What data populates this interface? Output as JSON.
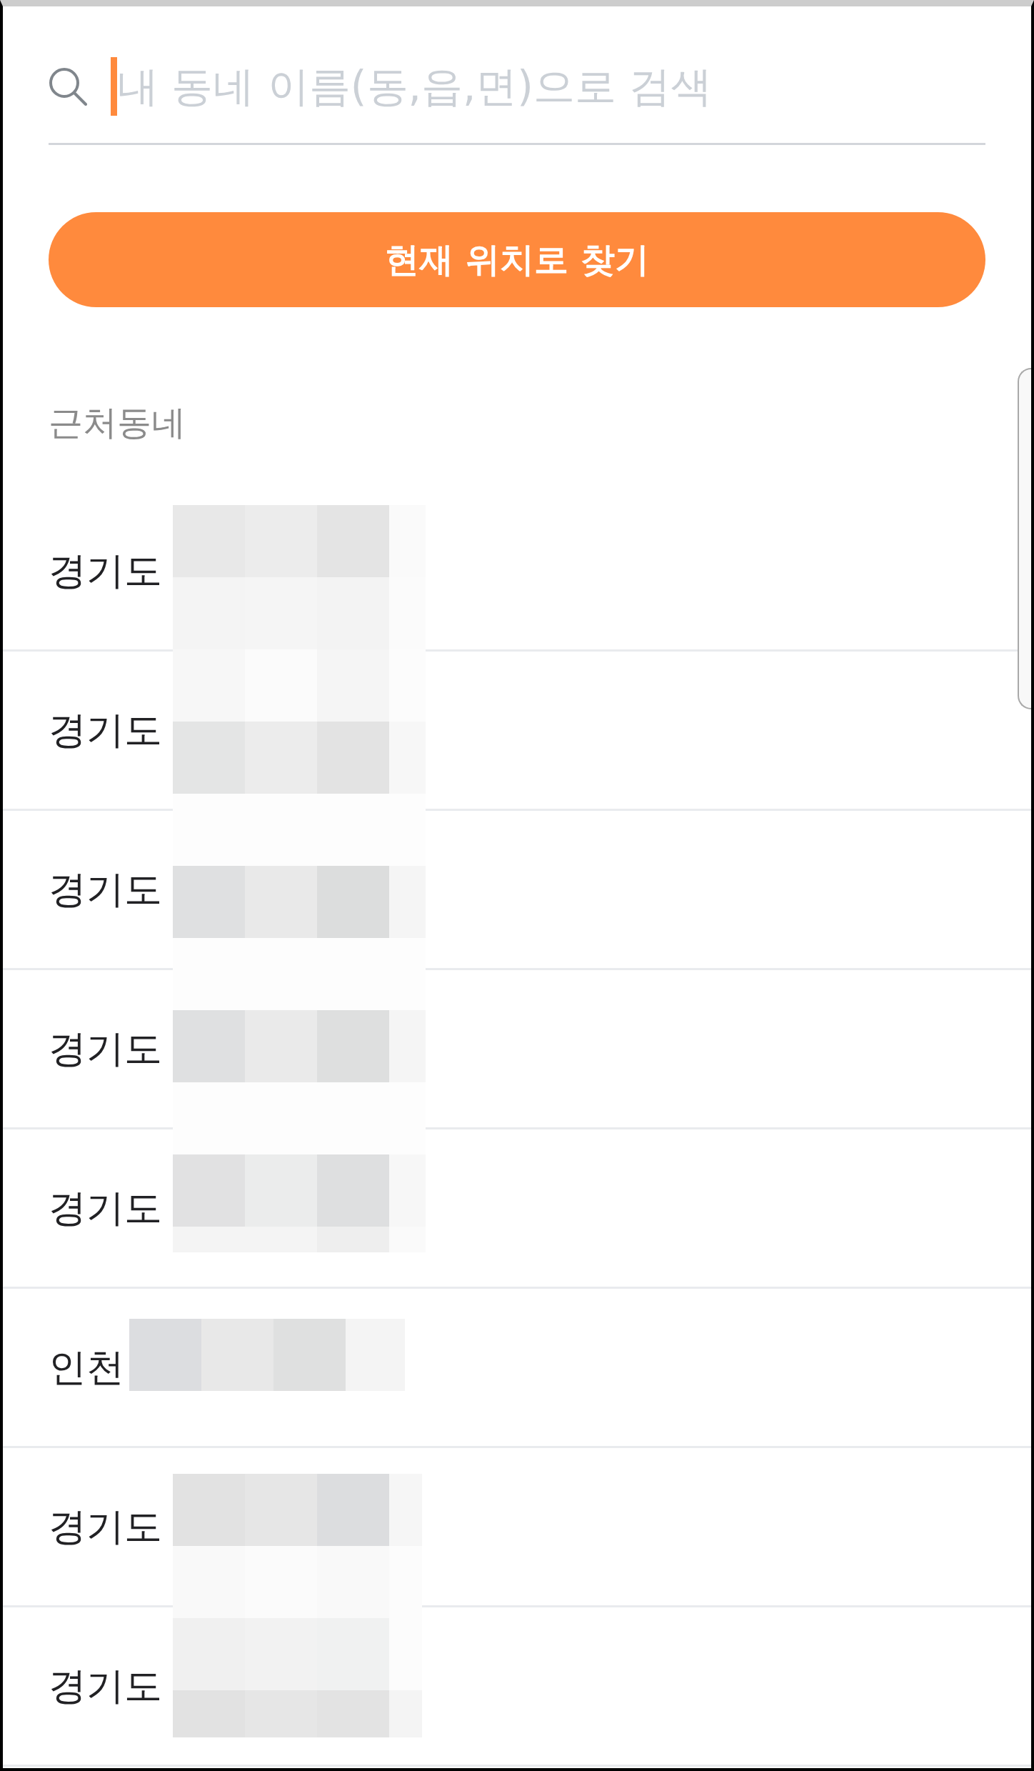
{
  "search": {
    "placeholder": "내 동네 이름(동,읍,면)으로 검색",
    "focused": true
  },
  "locate_button": {
    "label": "현재 위치로 찾기"
  },
  "nearby": {
    "title": "근처동네",
    "items": [
      {
        "label": "경기도"
      },
      {
        "label": "경기도"
      },
      {
        "label": "경기도"
      },
      {
        "label": "경기도"
      },
      {
        "label": "경기도"
      },
      {
        "label": "인천"
      },
      {
        "label": "경기도"
      },
      {
        "label": "경기도"
      }
    ]
  }
}
